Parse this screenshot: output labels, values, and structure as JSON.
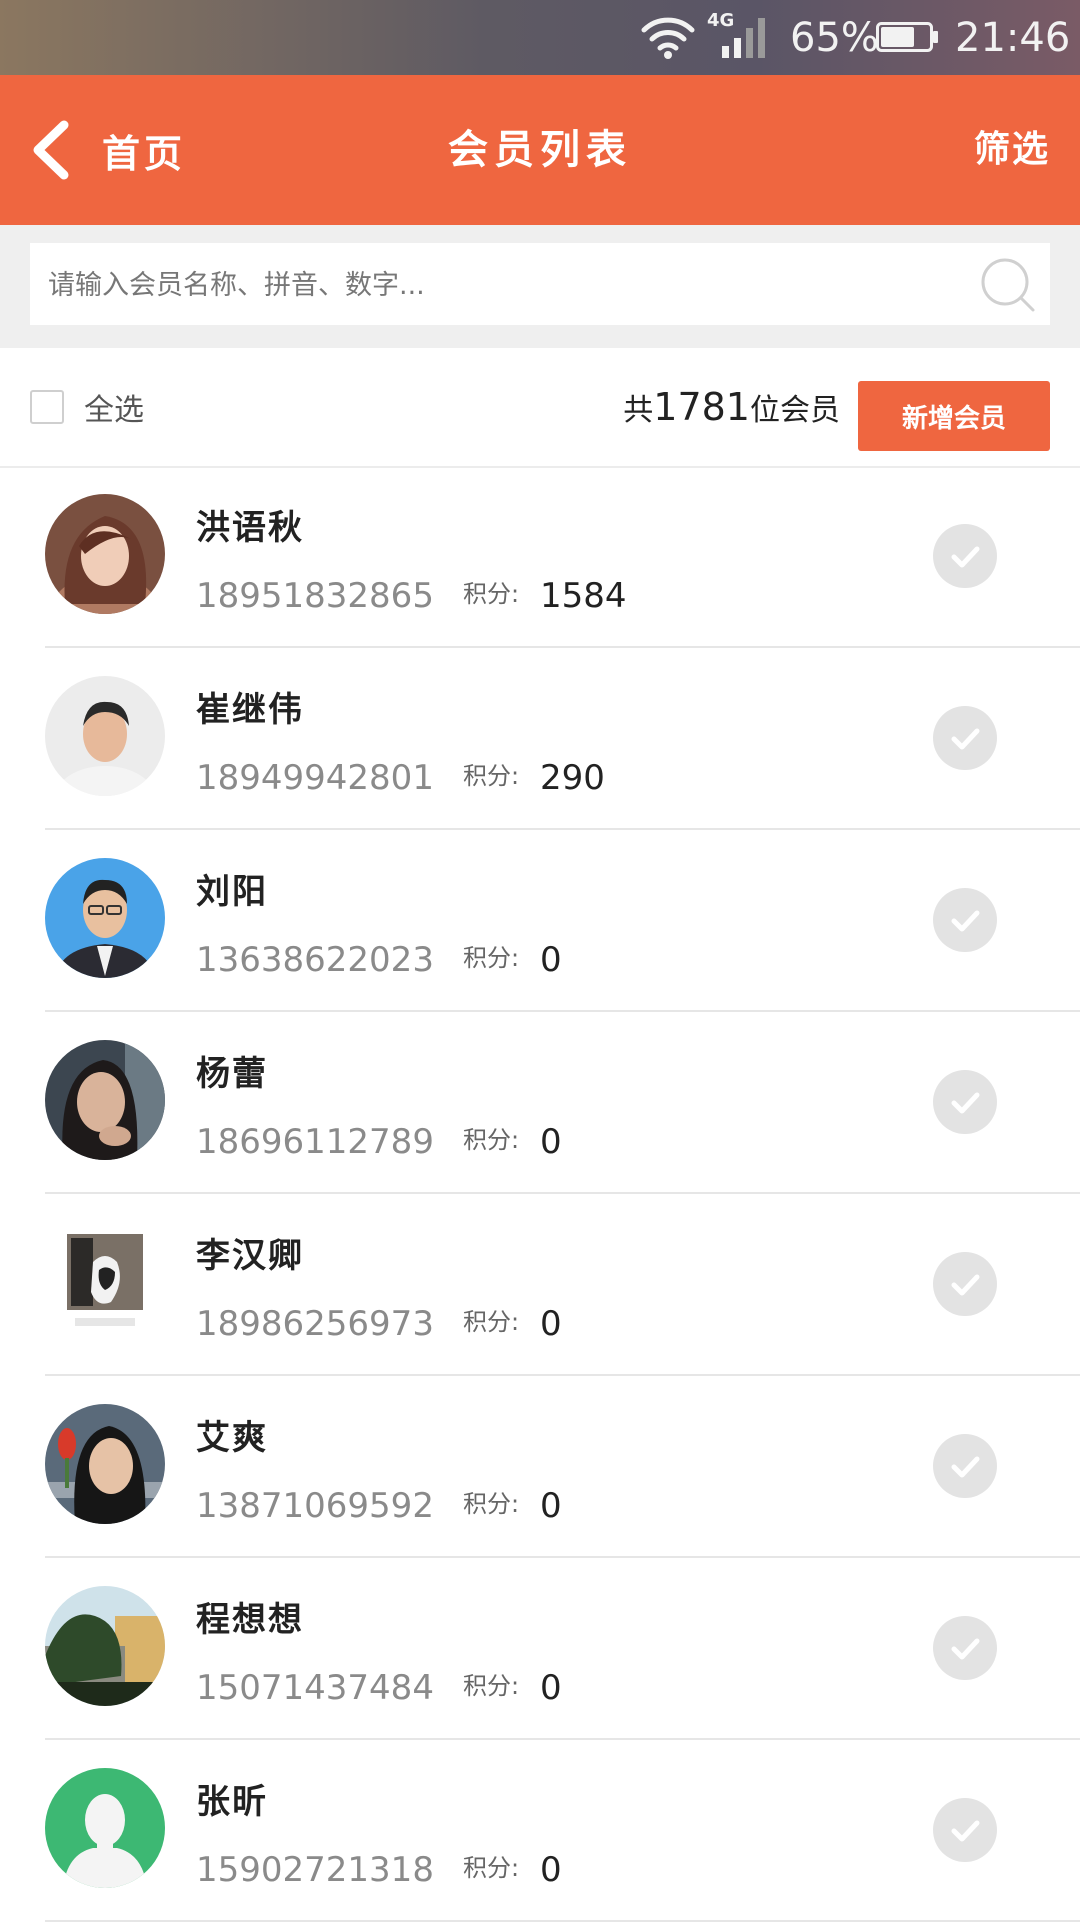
{
  "status_bar": {
    "network": "4G",
    "battery": "65%",
    "time": "21:46",
    "icons": [
      "wifi-icon",
      "signal-icon",
      "battery-icon"
    ]
  },
  "nav": {
    "back_label": "首页",
    "title": "会员列表",
    "filter_label": "筛选"
  },
  "search": {
    "placeholder": "请输入会员名称、拼音、数字..."
  },
  "toolbar": {
    "select_all_label": "全选",
    "count_prefix": "共",
    "count": "1781",
    "count_suffix": "位会员",
    "add_button_label": "新增会员"
  },
  "colors": {
    "brand": "#ef6640",
    "check_disabled": "#e3e3e3",
    "avatar_default": "#3db873"
  },
  "members": [
    {
      "name": "洪语秋",
      "phone": "18951832865",
      "points_label": "积分:",
      "points": "1584",
      "avatar": "photo-female-avatar"
    },
    {
      "name": "崔继伟",
      "phone": "18949942801",
      "points_label": "积分:",
      "points": "290",
      "avatar": "photo-male-avatar"
    },
    {
      "name": "刘阳",
      "phone": "13638622023",
      "points_label": "积分:",
      "points": "0",
      "avatar": "photo-male-suit-avatar"
    },
    {
      "name": "杨蕾",
      "phone": "18696112789",
      "points_label": "积分:",
      "points": "0",
      "avatar": "photo-female-avatar"
    },
    {
      "name": "李汉卿",
      "phone": "18986256973",
      "points_label": "积分:",
      "points": "0",
      "avatar": "photo-cat-avatar"
    },
    {
      "name": "艾爽",
      "phone": "13871069592",
      "points_label": "积分:",
      "points": "0",
      "avatar": "photo-female-avatar"
    },
    {
      "name": "程想想",
      "phone": "15071437484",
      "points_label": "积分:",
      "points": "0",
      "avatar": "photo-landscape-avatar"
    },
    {
      "name": "张昕",
      "phone": "15902721318",
      "points_label": "积分:",
      "points": "0",
      "avatar": "default-user-avatar"
    }
  ]
}
